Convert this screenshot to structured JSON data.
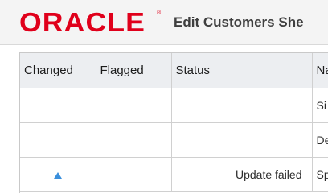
{
  "header": {
    "logo_text": "ORACLE",
    "logo_mark": "®",
    "title": "Edit Customers She"
  },
  "table": {
    "columns": [
      "Changed",
      "Flagged",
      "Status",
      "Na"
    ],
    "rows": [
      {
        "changed": "",
        "flagged": "",
        "status": "",
        "name": "Si"
      },
      {
        "changed": "",
        "flagged": "",
        "status": "",
        "name": "De"
      },
      {
        "changed": "up-arrow-icon",
        "flagged": "",
        "status": "Update failed",
        "name": "Sp"
      }
    ]
  },
  "colors": {
    "brand_red": "#e0001b",
    "arrow_blue": "#3a8fdc"
  }
}
